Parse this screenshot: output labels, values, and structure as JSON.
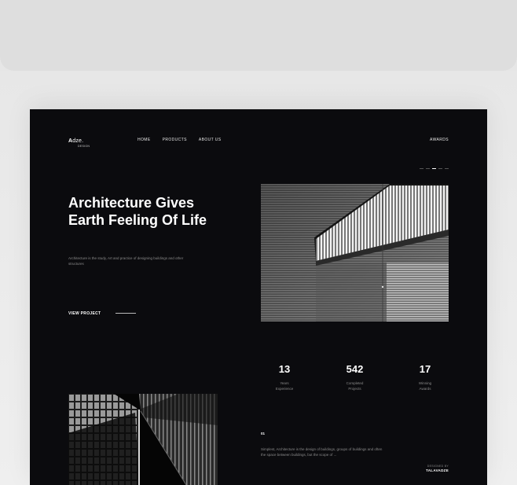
{
  "logo": {
    "main_prefix": "A",
    "main_rest": "dze.",
    "sub": "DESIGN"
  },
  "nav": {
    "items": [
      "HOME",
      "PRODUCTS",
      "ABOUT US"
    ],
    "right_link": "AWARDS"
  },
  "pager": {
    "count": 5,
    "active_index": 2
  },
  "hero": {
    "title": "Architecture Gives Earth Feeling Of Life",
    "subtitle": "Architecture is the study, Art and practice of designing buildings and other structures",
    "cta": "VIEW PROJECT",
    "image_name": "building-facade-photo"
  },
  "stats": [
    {
      "value": "13",
      "label_line1": "Years",
      "label_line2": "Experience"
    },
    {
      "value": "542",
      "label_line1": "Completed",
      "label_line2": "Projects"
    },
    {
      "value": "17",
      "label_line1": "Winning",
      "label_line2": "Awards"
    }
  ],
  "section": {
    "number": "01",
    "text": "Simplest, Architecture is the design of buildings, groups of buildings and often the space between buildings, but the scope of ..."
  },
  "credit": {
    "top": "DESIGNED BY",
    "name": "TALAVADZE"
  },
  "colors": {
    "background": "#0b0b0e",
    "text": "#ffffff",
    "muted": "#8a8a8a"
  }
}
